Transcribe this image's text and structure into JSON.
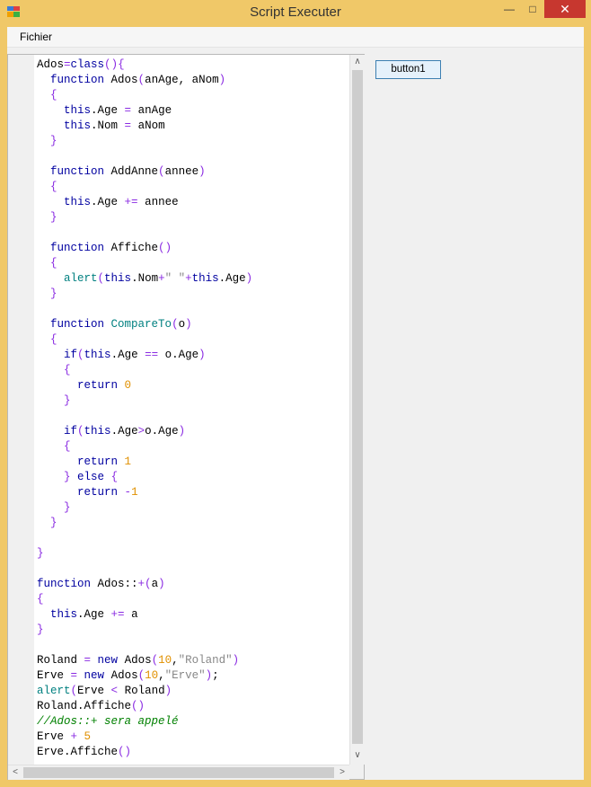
{
  "window": {
    "title": "Script Executer",
    "minimize": "—",
    "maximize": "□",
    "close": "✕"
  },
  "menu": {
    "file_label": "Fichier"
  },
  "button1_label": "button1",
  "scroll": {
    "up": "∧",
    "down": "∨",
    "left": "<",
    "right": ">"
  },
  "code_lines": [
    "Ados=class(){",
    "  function Ados(anAge, aNom)",
    "  {",
    "    this.Age = anAge",
    "    this.Nom = aNom",
    "  }",
    "",
    "  function AddAnne(annee)",
    "  {",
    "    this.Age += annee",
    "  }",
    "",
    "  function Affiche()",
    "  {",
    "    alert(this.Nom+\" \"+this.Age)",
    "  }",
    "",
    "  function CompareTo(o)",
    "  {",
    "    if(this.Age == o.Age)",
    "    {",
    "      return 0",
    "    }",
    "",
    "    if(this.Age>o.Age)",
    "    {",
    "      return 1",
    "    } else {",
    "      return -1",
    "    }",
    "  }",
    "",
    "}",
    "",
    "function Ados::+(a)",
    "{",
    "  this.Age += a",
    "}",
    "",
    "Roland = new Ados(10,\"Roland\")",
    "Erve = new Ados(10,\"Erve\");",
    "alert(Erve < Roland)",
    "Roland.Affiche()",
    "//Ados::+ sera appelé",
    "Erve + 5",
    "Erve.Affiche()"
  ]
}
